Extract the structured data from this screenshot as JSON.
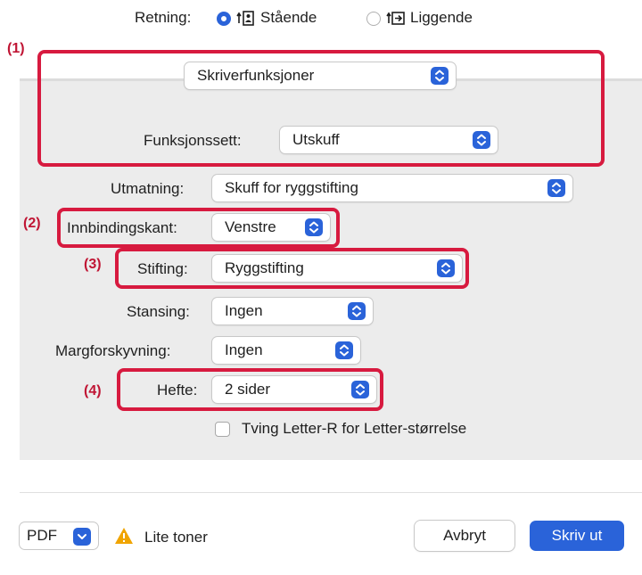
{
  "orientation": {
    "label": "Retning:",
    "portrait": "Stående",
    "landscape": "Liggende",
    "selected": "portrait"
  },
  "markers": {
    "m1": "(1)",
    "m2": "(2)",
    "m3": "(3)",
    "m4": "(4)"
  },
  "panel_menu": {
    "value": "Skriverfunksjoner"
  },
  "feature_set": {
    "label": "Funksjonssett:",
    "value": "Utskuff"
  },
  "fields": {
    "output": {
      "label": "Utmatning:",
      "value": "Skuff for ryggstifting"
    },
    "binding_edge": {
      "label": "Innbindingskant:",
      "value": "Venstre"
    },
    "stapling": {
      "label": "Stifting:",
      "value": "Ryggstifting"
    },
    "punching": {
      "label": "Stansing:",
      "value": "Ingen"
    },
    "margin_shift": {
      "label": "Margforskyvning:",
      "value": "Ingen"
    },
    "booklet": {
      "label": "Hefte:",
      "value": "2 sider"
    }
  },
  "force_letter": {
    "label": "Tving Letter-R for Letter-størrelse",
    "checked": false
  },
  "footer": {
    "pdf": "PDF",
    "warning": "Lite toner",
    "cancel": "Avbryt",
    "print": "Skriv ut"
  },
  "colors": {
    "accent": "#2a63d9",
    "highlight": "#d71a3f",
    "warning": "#f0a400"
  }
}
